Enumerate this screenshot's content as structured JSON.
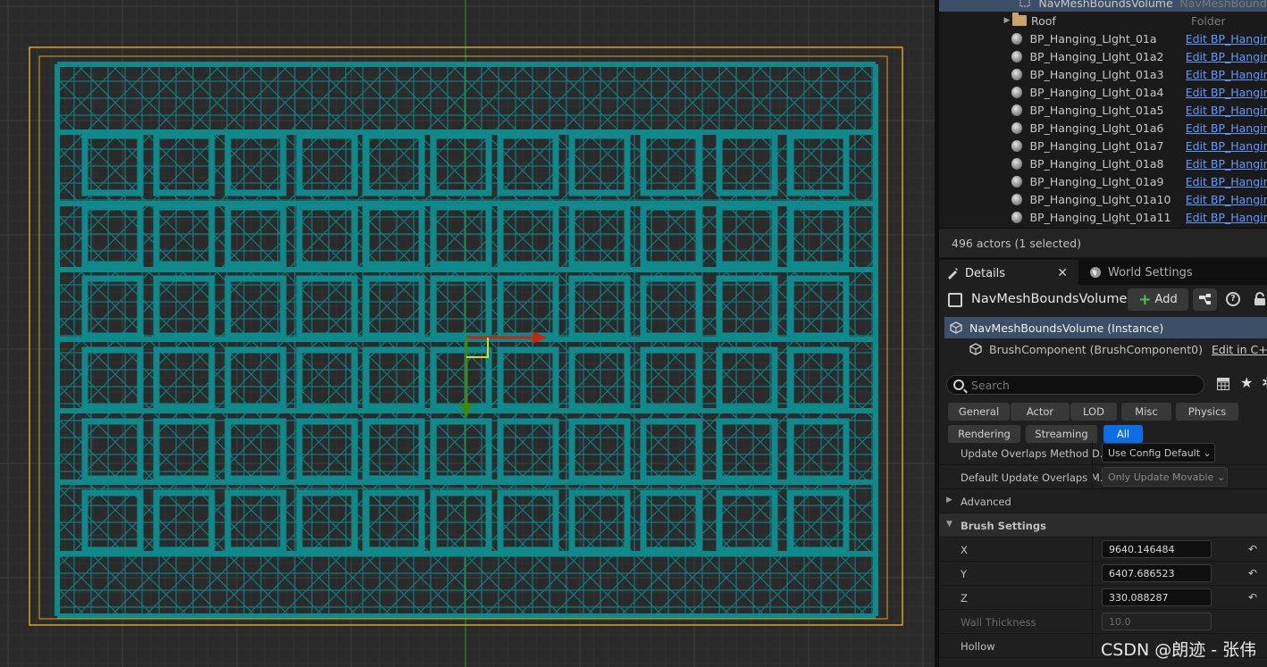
{
  "colors": {
    "wire": "#0e8a8c",
    "bounds": "#d7a51c",
    "grid_bg": "#2a2a2a",
    "axis_green": "#1fa41f",
    "gizmo_red": "#c8260e",
    "gizmo_green": "#3b8a0f",
    "selection": "#3c4f66",
    "accent": "#0a6ee6"
  },
  "outliner": {
    "rows": [
      {
        "label": "NavMeshBoundsVolume",
        "type": "NavMeshBounds",
        "icon": "volume-icon",
        "selected": true,
        "link": false
      },
      {
        "label": "Roof",
        "type": "Folder",
        "icon": "folder-icon",
        "selected": false,
        "link": false
      },
      {
        "label": "BP_Hanging_LIght_01a",
        "type": "Edit BP_Hangin",
        "icon": "sphere-actor-icon",
        "selected": false,
        "link": true
      },
      {
        "label": "BP_Hanging_LIght_01a2",
        "type": "Edit BP_Hangin",
        "icon": "sphere-actor-icon",
        "selected": false,
        "link": true
      },
      {
        "label": "BP_Hanging_LIght_01a3",
        "type": "Edit BP_Hangin",
        "icon": "sphere-actor-icon",
        "selected": false,
        "link": true
      },
      {
        "label": "BP_Hanging_LIght_01a4",
        "type": "Edit BP_Hangin",
        "icon": "sphere-actor-icon",
        "selected": false,
        "link": true
      },
      {
        "label": "BP_Hanging_LIght_01a5",
        "type": "Edit BP_Hangin",
        "icon": "sphere-actor-icon",
        "selected": false,
        "link": true
      },
      {
        "label": "BP_Hanging_LIght_01a6",
        "type": "Edit BP_Hangin",
        "icon": "sphere-actor-icon",
        "selected": false,
        "link": true
      },
      {
        "label": "BP_Hanging_LIght_01a7",
        "type": "Edit BP_Hangin",
        "icon": "sphere-actor-icon",
        "selected": false,
        "link": true
      },
      {
        "label": "BP_Hanging_LIght_01a8",
        "type": "Edit BP_Hangin",
        "icon": "sphere-actor-icon",
        "selected": false,
        "link": true
      },
      {
        "label": "BP_Hanging_LIght_01a9",
        "type": "Edit BP_Hangin",
        "icon": "sphere-actor-icon",
        "selected": false,
        "link": true
      },
      {
        "label": "BP_Hanging_LIght_01a10",
        "type": "Edit BP_Hangin",
        "icon": "sphere-actor-icon",
        "selected": false,
        "link": true
      },
      {
        "label": "BP_Hanging_LIght_01a11",
        "type": "Edit BP_Hangin",
        "icon": "sphere-actor-icon",
        "selected": false,
        "link": true
      }
    ],
    "actor_count": "496 actors (1 selected)"
  },
  "tabs": {
    "details": "Details",
    "world_settings": "World Settings"
  },
  "details": {
    "object_name": "NavMeshBoundsVolume",
    "add_label": "Add",
    "components": [
      {
        "label": "NavMeshBoundsVolume (Instance)",
        "selected": true
      },
      {
        "label": "BrushComponent (BrushComponent0)",
        "selected": false
      }
    ],
    "edit_cpp": "Edit in C++",
    "search_placeholder": "Search",
    "filters_row1": [
      "General",
      "Actor",
      "LOD",
      "Misc",
      "Physics"
    ],
    "filters_row2": [
      "Rendering",
      "Streaming",
      "All"
    ],
    "active_filter": "All",
    "properties": {
      "update_overlaps_label": "Update Overlaps Method D...",
      "update_overlaps_value": "Use Config Default",
      "default_update_overlaps_label": "Default Update Overlaps M...",
      "default_update_overlaps_value": "Only Update Movable",
      "advanced_label": "Advanced",
      "brush_settings_label": "Brush Settings",
      "x_label": "X",
      "x_value": "9640.146484",
      "y_label": "Y",
      "y_value": "6407.686523",
      "z_label": "Z",
      "z_value": "330.088287",
      "wall_thickness_label": "Wall Thickness",
      "wall_thickness_value": "10.0",
      "hollow_label": "Hollow"
    }
  },
  "watermark": "CSDN @朗迹 - 张伟"
}
